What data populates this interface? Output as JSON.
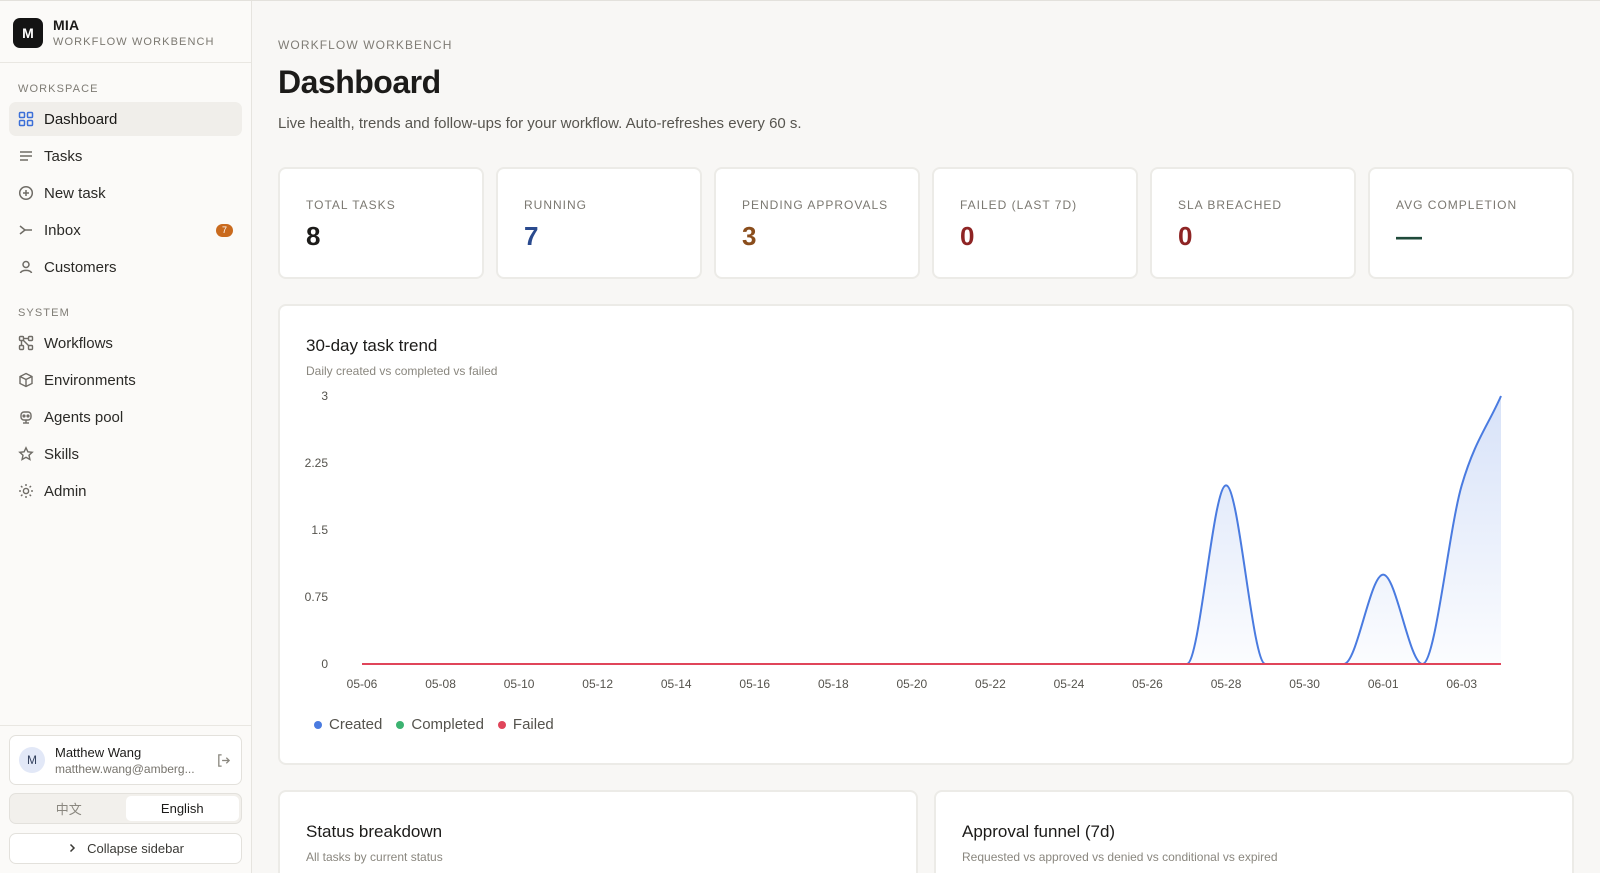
{
  "brand": {
    "logo_letter": "M",
    "name": "MIA",
    "subtitle": "WORKFLOW WORKBENCH"
  },
  "sidebar": {
    "workspace_heading": "WORKSPACE",
    "workspace_items": [
      {
        "label": "Dashboard",
        "icon": "grid-icon",
        "active": true
      },
      {
        "label": "Tasks",
        "icon": "list-icon"
      },
      {
        "label": "New task",
        "icon": "plus-circle-icon"
      },
      {
        "label": "Inbox",
        "icon": "inbox-icon",
        "badge": "7"
      },
      {
        "label": "Customers",
        "icon": "user-icon"
      }
    ],
    "system_heading": "SYSTEM",
    "system_items": [
      {
        "label": "Workflows",
        "icon": "workflow-icon"
      },
      {
        "label": "Environments",
        "icon": "cube-icon"
      },
      {
        "label": "Agents pool",
        "icon": "robot-icon"
      },
      {
        "label": "Skills",
        "icon": "star-icon"
      },
      {
        "label": "Admin",
        "icon": "sun-gear-icon"
      }
    ],
    "user": {
      "initial": "M",
      "name": "Matthew Wang",
      "email": "matthew.wang@amberg..."
    },
    "lang": {
      "zh": "中文",
      "en": "English",
      "active": "en"
    },
    "collapse_label": "Collapse sidebar"
  },
  "header": {
    "eyebrow": "WORKFLOW WORKBENCH",
    "title": "Dashboard",
    "description": "Live health, trends and follow-ups for your workflow. Auto-refreshes every 60 s."
  },
  "kpis": [
    {
      "label": "TOTAL TASKS",
      "value": "8",
      "color": "#1c1b19"
    },
    {
      "label": "RUNNING",
      "value": "7",
      "color": "#2a4a8e"
    },
    {
      "label": "PENDING APPROVALS",
      "value": "3",
      "color": "#8a4d1c"
    },
    {
      "label": "FAILED (LAST 7D)",
      "value": "0",
      "color": "#8e2424"
    },
    {
      "label": "SLA BREACHED",
      "value": "0",
      "color": "#8e2424"
    },
    {
      "label": "AVG COMPLETION",
      "value": "—",
      "color": "#1f4a3a"
    }
  ],
  "trend": {
    "title": "30-day task trend",
    "subtitle": "Daily created vs completed vs failed"
  },
  "chart_data": {
    "type": "area",
    "x": [
      "05-06",
      "05-07",
      "05-08",
      "05-09",
      "05-10",
      "05-11",
      "05-12",
      "05-13",
      "05-14",
      "05-15",
      "05-16",
      "05-17",
      "05-18",
      "05-19",
      "05-20",
      "05-21",
      "05-22",
      "05-23",
      "05-24",
      "05-25",
      "05-26",
      "05-27",
      "05-28",
      "05-29",
      "05-30",
      "05-31",
      "06-01",
      "06-02",
      "06-03",
      "06-04"
    ],
    "x_ticks": [
      "05-06",
      "05-08",
      "05-10",
      "05-12",
      "05-14",
      "05-16",
      "05-18",
      "05-20",
      "05-22",
      "05-24",
      "05-26",
      "05-28",
      "05-30",
      "06-01",
      "06-03"
    ],
    "y_ticks": [
      "0",
      "0.75",
      "1.5",
      "2.25",
      "3"
    ],
    "ylim": [
      0,
      3
    ],
    "series": [
      {
        "name": "Created",
        "color": "#4a7be0",
        "values": [
          0,
          0,
          0,
          0,
          0,
          0,
          0,
          0,
          0,
          0,
          0,
          0,
          0,
          0,
          0,
          0,
          0,
          0,
          0,
          0,
          0,
          0,
          2,
          0,
          0,
          0,
          1,
          0,
          2,
          3
        ]
      },
      {
        "name": "Completed",
        "color": "#3cb371",
        "values": [
          0,
          0,
          0,
          0,
          0,
          0,
          0,
          0,
          0,
          0,
          0,
          0,
          0,
          0,
          0,
          0,
          0,
          0,
          0,
          0,
          0,
          0,
          0,
          0,
          0,
          0,
          0,
          0,
          0,
          0
        ]
      },
      {
        "name": "Failed",
        "color": "#e0455a",
        "values": [
          0,
          0,
          0,
          0,
          0,
          0,
          0,
          0,
          0,
          0,
          0,
          0,
          0,
          0,
          0,
          0,
          0,
          0,
          0,
          0,
          0,
          0,
          0,
          0,
          0,
          0,
          0,
          0,
          0,
          0
        ]
      }
    ]
  },
  "status_panel": {
    "title": "Status breakdown",
    "subtitle": "All tasks by current status"
  },
  "funnel_panel": {
    "title": "Approval funnel (7d)",
    "subtitle": "Requested vs approved vs denied vs conditional vs expired"
  }
}
